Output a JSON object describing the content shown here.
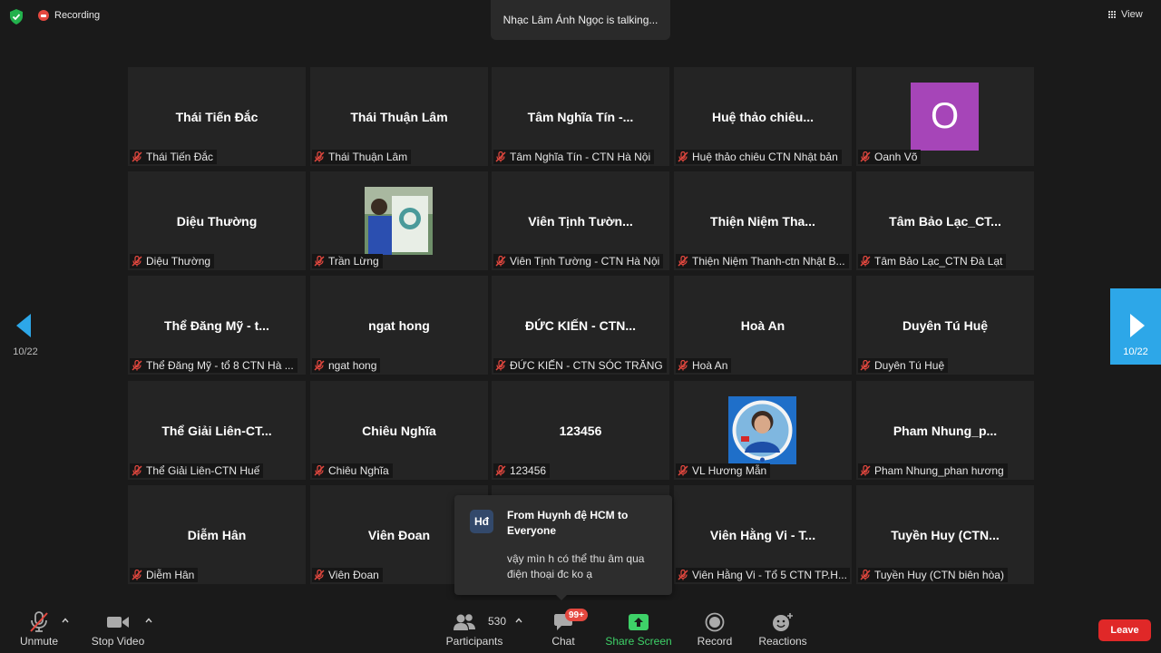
{
  "top": {
    "recording_label": "Recording",
    "talking_text": "Nhạc Lâm Ánh Ngọc is talking...",
    "view_label": "View"
  },
  "pager": {
    "left_count": "10/22",
    "right_count": "10/22"
  },
  "tiles": [
    {
      "name": "Thái Tiến Đắc",
      "label": "Thái Tiến Đắc"
    },
    {
      "name": "Thái Thuận Lâm",
      "label": "Thái Thuận Lâm"
    },
    {
      "name": "Tâm Nghĩa Tín -...",
      "label": "Tâm Nghĩa Tín - CTN Hà Nội"
    },
    {
      "name": "Huệ thảo chiêu...",
      "label": "Huệ thảo chiêu CTN Nhật bản"
    },
    {
      "name": "",
      "label": "Oanh Võ",
      "avatar_letter": "O"
    },
    {
      "name": "Diệu Thường",
      "label": "Diệu Thường"
    },
    {
      "name": "",
      "label": "Trần Lừng",
      "photo": true
    },
    {
      "name": "Viên Tịnh Tườn...",
      "label": "Viên Tịnh Tường - CTN Hà Nội"
    },
    {
      "name": "Thiện Niệm Tha...",
      "label": "Thiện Niệm Thanh-ctn Nhật B..."
    },
    {
      "name": "Tâm Bảo Lạc_CT...",
      "label": "Tâm Bảo Lạc_CTN Đà Lạt"
    },
    {
      "name": "Thể Đăng Mỹ - t...",
      "label": "Thể Đăng Mỹ - tổ 8 CTN Hà ..."
    },
    {
      "name": "ngat hong",
      "label": "ngat hong"
    },
    {
      "name": "ĐỨC KIẾN - CTN...",
      "label": "ĐỨC KIẾN - CTN SÓC TRĂNG"
    },
    {
      "name": "Hoà An",
      "label": "Hoà An"
    },
    {
      "name": "Duyên Tú Huệ",
      "label": "Duyên Tú Huệ"
    },
    {
      "name": "Thể Giải Liên-CT...",
      "label": "Thể Giải Liên-CTN Huế"
    },
    {
      "name": "Chiêu Nghĩa",
      "label": "Chiêu Nghĩa"
    },
    {
      "name": "123456",
      "label": "123456"
    },
    {
      "name": "",
      "label": "VL Hương Mẫn",
      "photo": true
    },
    {
      "name": "Pham  Nhung_p...",
      "label": "Pham Nhung_phan hương"
    },
    {
      "name": "Diễm Hân",
      "label": "Diễm Hân"
    },
    {
      "name": "Viên Đoan",
      "label": "Viên Đoan"
    },
    {
      "name": "",
      "label": ""
    },
    {
      "name": "Viên Hằng Vi - T...",
      "label": "Viên Hằng Vi - Tổ 5 CTN TP.H..."
    },
    {
      "name": "Tuyền Huy (CTN...",
      "label": "Tuyền Huy (CTN biên hòa)"
    }
  ],
  "chat_popup": {
    "avatar": "Hđ",
    "from": "From Huynh đệ HCM to Everyone",
    "message": "vậy mìn h có thể thu âm qua điện thoại đc ko ạ"
  },
  "toolbar": {
    "unmute": "Unmute",
    "stop_video": "Stop Video",
    "participants": "Participants",
    "participant_count": "530",
    "chat": "Chat",
    "chat_badge": "99+",
    "share_screen": "Share Screen",
    "record": "Record",
    "reactions": "Reactions",
    "leave": "Leave"
  },
  "colors": {
    "share_green": "#3ed168",
    "nav_blue": "#2da7e8",
    "leave_red": "#e02828",
    "avatar_purple": "#a645b8",
    "mute_red": "#e5483f"
  }
}
